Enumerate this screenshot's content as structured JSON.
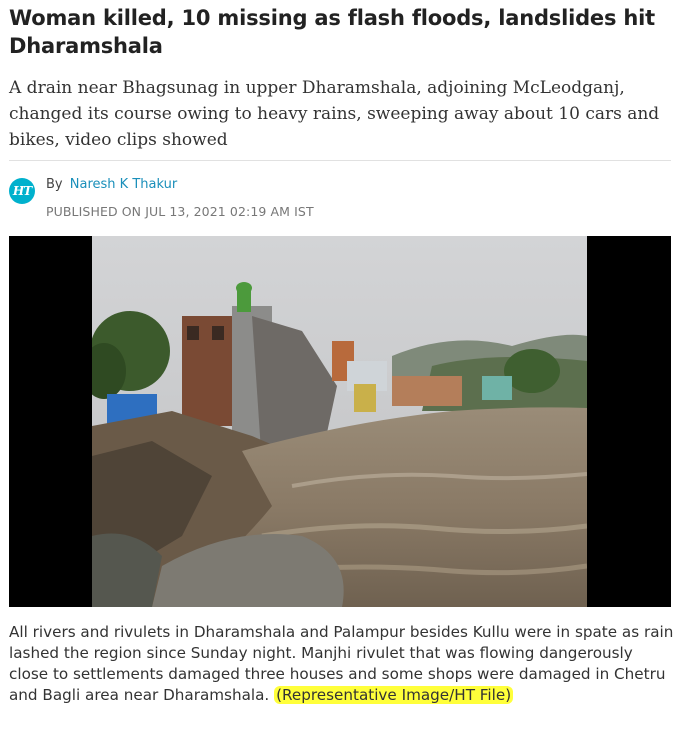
{
  "article": {
    "headline": "Woman killed, 10 missing as flash floods, landslides hit Dharamshala",
    "summary": "A drain near Bhagsunag in upper Dharamshala, adjoining McLeodganj, changed its course owing to heavy rains, sweeping away about 10 cars and bikes, video clips showed",
    "byline": {
      "logo_text": "HT",
      "by_prefix": "By",
      "author": "Naresh K Thakur",
      "published": "PUBLISHED ON JUL 13, 2021 02:19 AM IST"
    },
    "image": {
      "caption": "All rivers and rivulets in Dharamshala and Palampur besides Kullu were in spate as rain lashed the region since Sunday night. Manjhi rivulet that was flowing dangerously close to settlements damaged three houses and some shops were damaged in Chetru and Bagli area near Dharamshala.",
      "credit": "(Representative Image/HT File)"
    }
  },
  "colors": {
    "link": "#1a8fba",
    "ht_brand": "#00b1cd",
    "highlight": "#ffff3a"
  }
}
